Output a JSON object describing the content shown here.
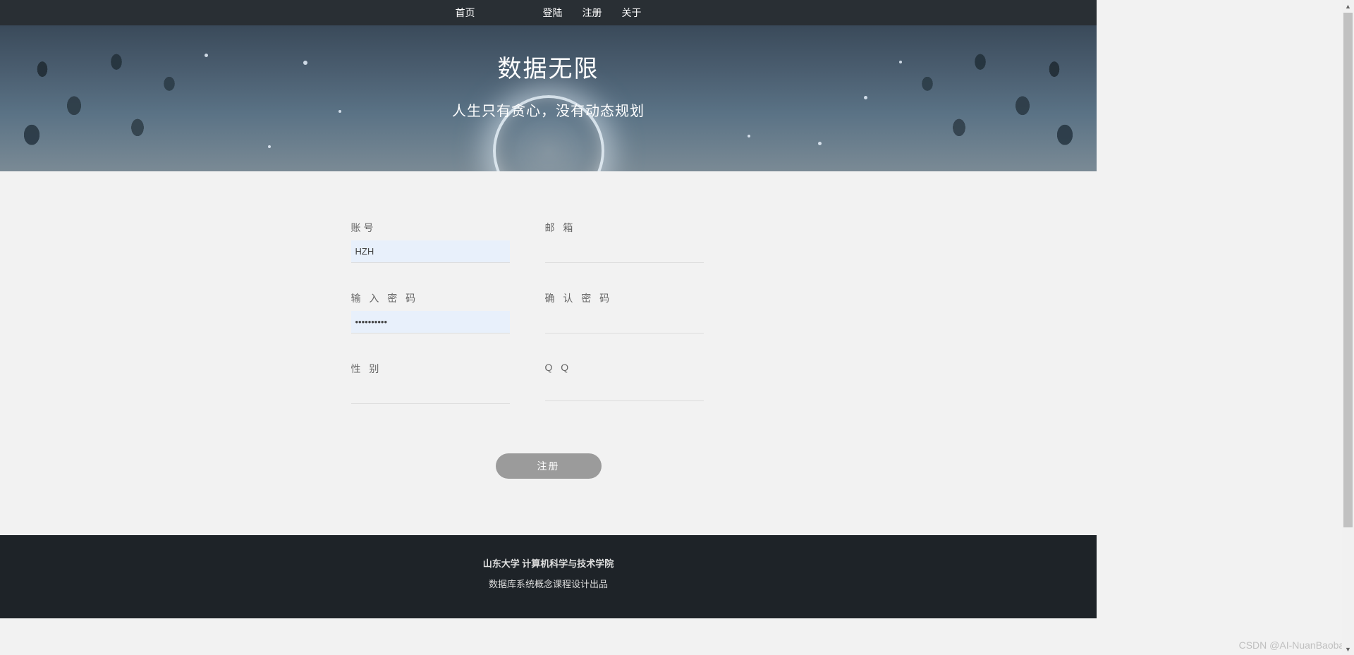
{
  "nav": {
    "home": "首页",
    "login": "登陆",
    "register": "注册",
    "about": "关于"
  },
  "hero": {
    "title": "数据无限",
    "subtitle": "人生只有贪心，没有动态规划"
  },
  "form": {
    "account": {
      "label": "账号",
      "value": "HZH"
    },
    "email": {
      "label": "邮 箱",
      "value": ""
    },
    "password": {
      "label": "输 入 密 码",
      "value": "••••••••••"
    },
    "confirm": {
      "label": "确 认 密 码",
      "value": ""
    },
    "gender": {
      "label": "性 别",
      "value": ""
    },
    "qq": {
      "label": "Q Q",
      "value": ""
    },
    "submit": "注册"
  },
  "footer": {
    "line1": "山东大学 计算机科学与技术学院",
    "line2": "数据库系统概念课程设计出品"
  },
  "watermark": "CSDN @AI-NuanBaobao"
}
